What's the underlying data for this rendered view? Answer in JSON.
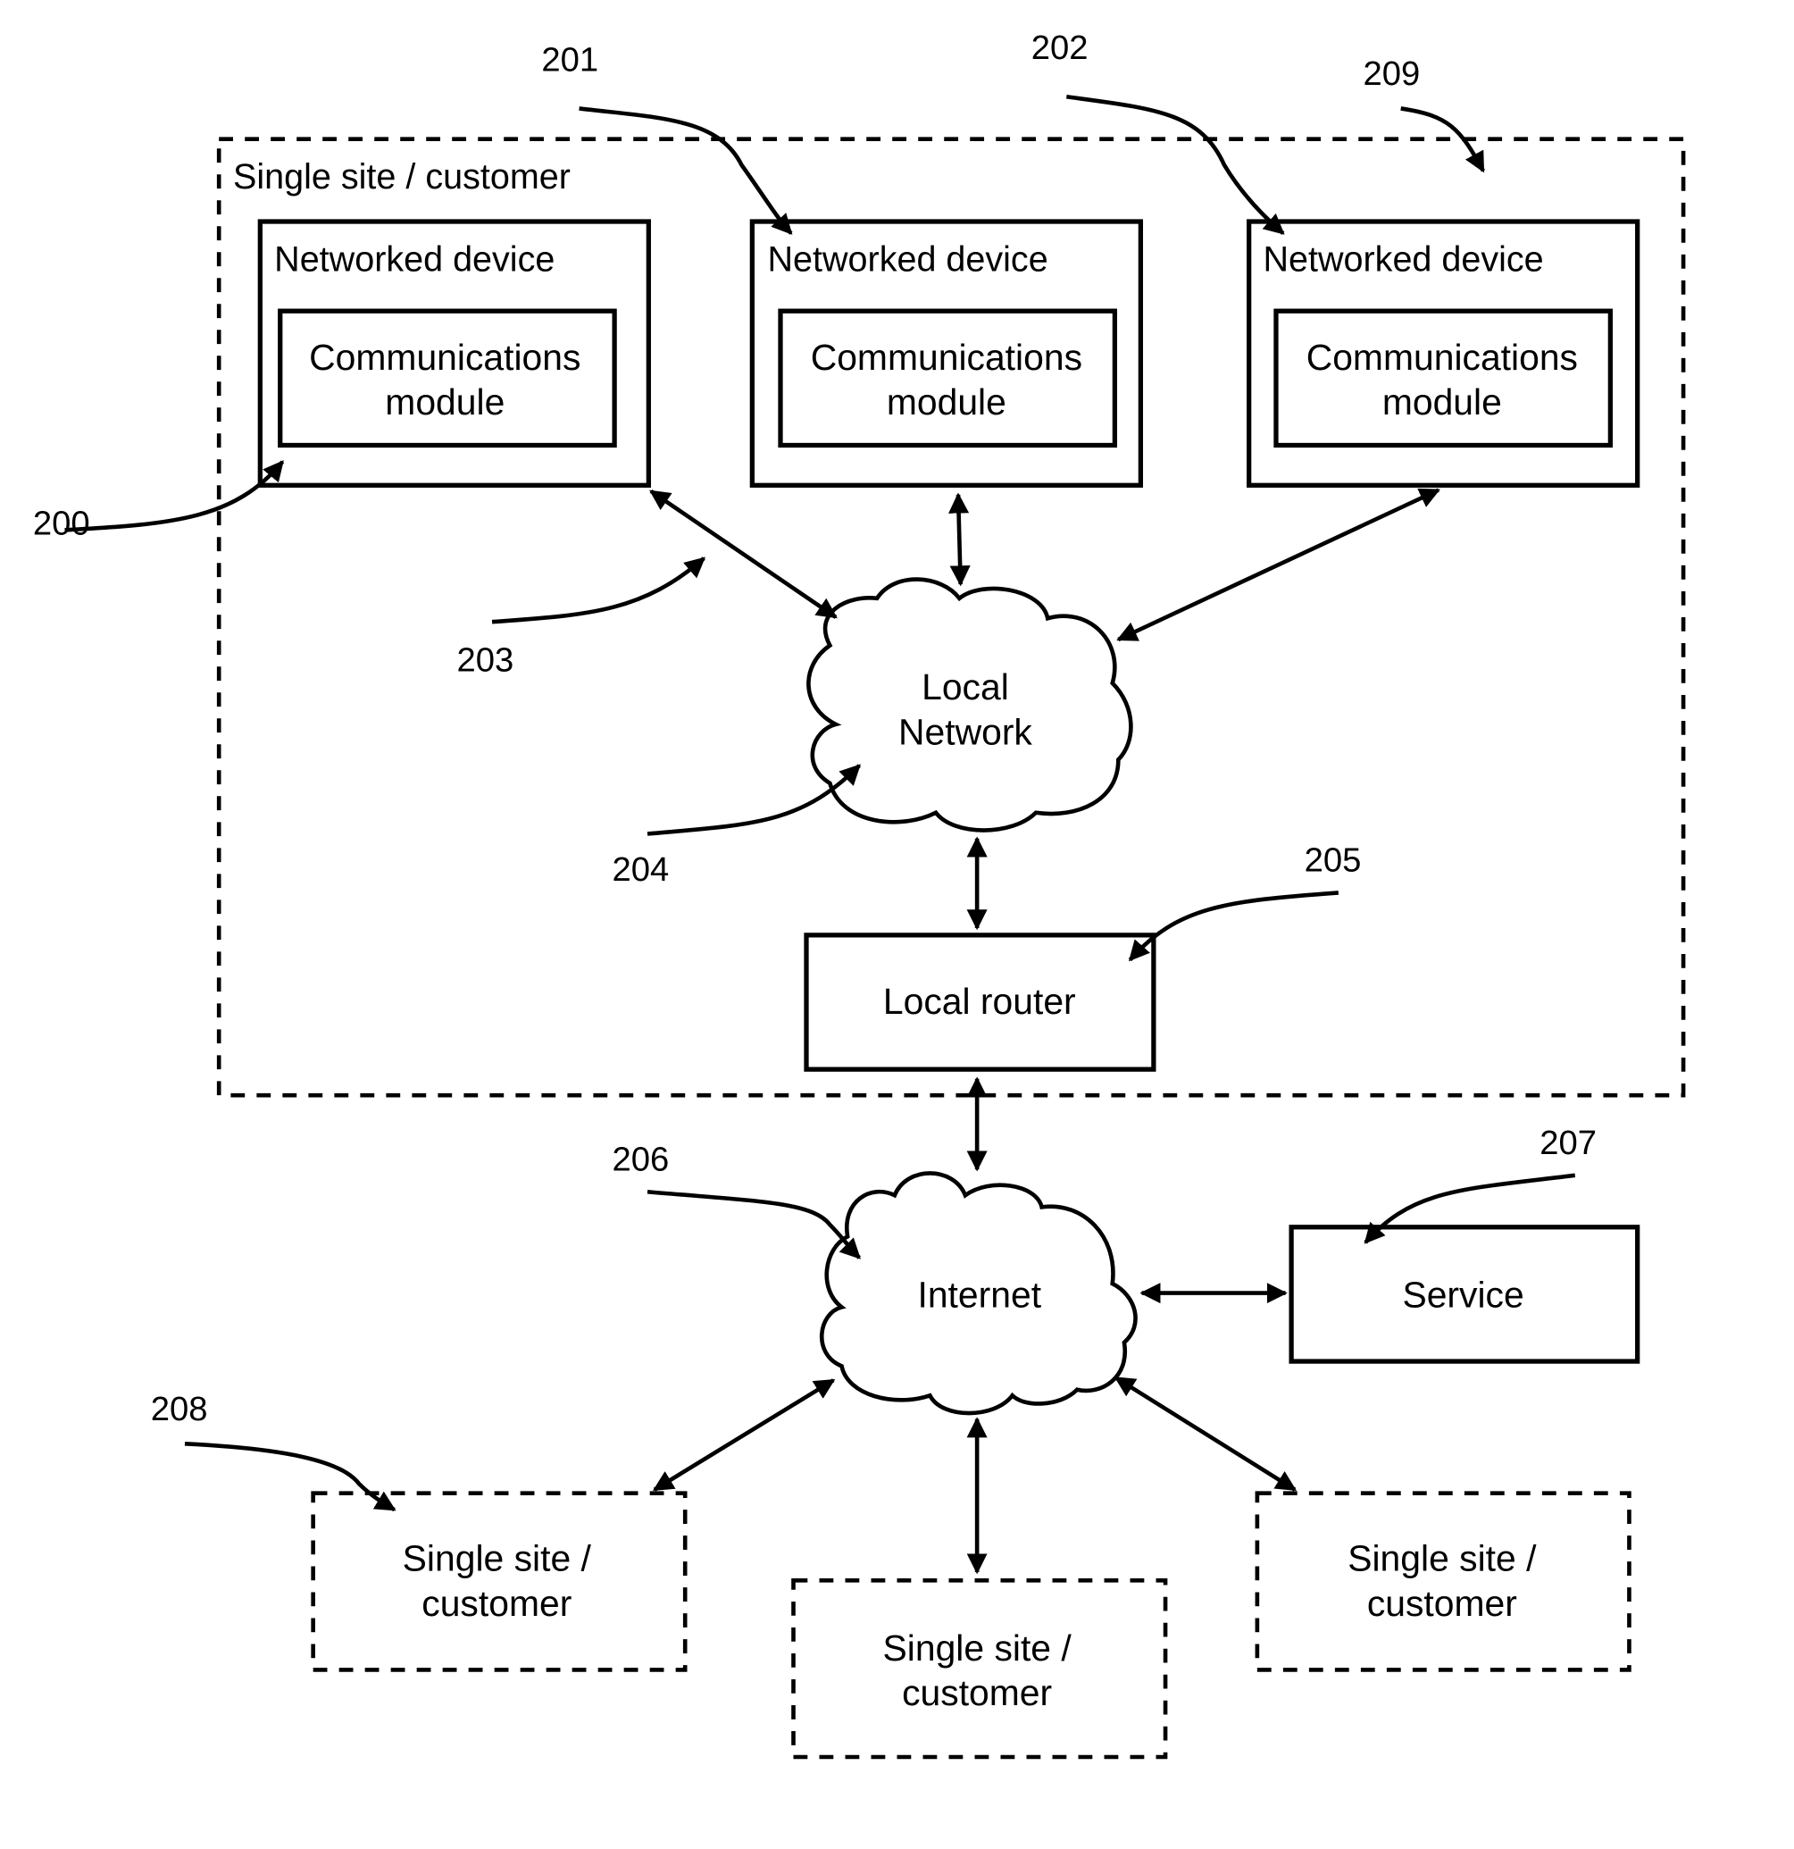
{
  "diagram": {
    "site_container": {
      "label": "Single site / customer",
      "ref": "209"
    },
    "networked_devices": [
      {
        "title": "Networked device",
        "module_line1": "Communications",
        "module_line2": "module",
        "ref": "200"
      },
      {
        "title": "Networked device",
        "module_line1": "Communications",
        "module_line2": "module",
        "ref": "201"
      },
      {
        "title": "Networked device",
        "module_line1": "Communications",
        "module_line2": "module",
        "ref": "202"
      }
    ],
    "connection_ref": "203",
    "local_network": {
      "line1": "Local",
      "line2": "Network",
      "ref": "204"
    },
    "local_router": {
      "label": "Local router",
      "ref": "205"
    },
    "internet": {
      "label": "Internet",
      "ref": "206"
    },
    "service": {
      "label": "Service",
      "ref": "207"
    },
    "remote_sites": [
      {
        "line1": "Single site /",
        "line2": "customer",
        "ref": "208"
      },
      {
        "line1": "Single site /",
        "line2": "customer"
      },
      {
        "line1": "Single site /",
        "line2": "customer"
      }
    ],
    "colors": {
      "ink": "#000000",
      "background": "#ffffff"
    }
  }
}
